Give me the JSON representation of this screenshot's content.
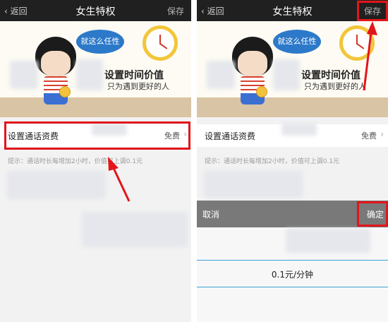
{
  "topbar": {
    "back_label": "返回",
    "title": "女生特权",
    "save_label": "保存"
  },
  "banner": {
    "bubble_text": "就这么任性",
    "slogan_main": "设置时间价值",
    "slogan_sub": "只为遇到更好的人"
  },
  "setting": {
    "label": "设置通话资费",
    "value": "免费"
  },
  "hint": "提示：通话时长每增加2小时，价值可上调0.1元",
  "action_bar": {
    "cancel_label": "取消",
    "confirm_label": "确定"
  },
  "picker": {
    "selected_value": "0.1元/分钟"
  },
  "colors": {
    "topbar": "#202020",
    "highlight": "#e2151b",
    "picker_line": "#38a1d6",
    "action_bar": "#797979"
  }
}
